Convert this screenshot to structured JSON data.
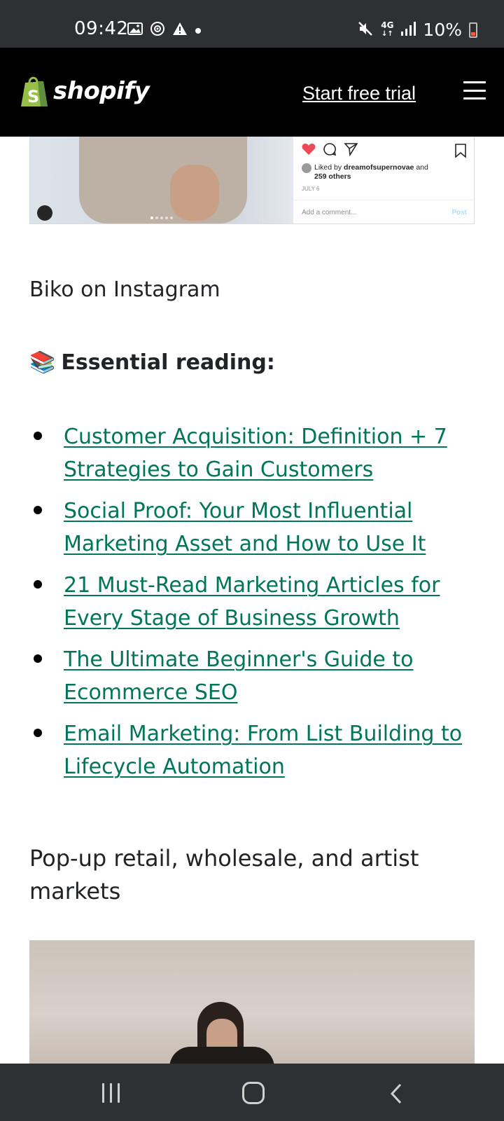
{
  "status_bar": {
    "time": "09:42",
    "battery_percent": "10%",
    "network": "4G",
    "icons_left": [
      "gallery-icon",
      "sync-icon",
      "alert-icon",
      "dot-icon"
    ],
    "icons_right": [
      "mute-icon",
      "4g-icon",
      "signal-icon",
      "battery-icon"
    ]
  },
  "header": {
    "logo_text": "shopify",
    "cta_label": "Start free trial",
    "menu_icon": "hamburger-menu-icon"
  },
  "instagram_embed": {
    "liked_by_prefix": "Liked by",
    "liked_by_user": "dreamofsupernovae",
    "liked_by_and": "and",
    "liked_by_others": "259 others",
    "date": "JULY 6",
    "comment_placeholder": "Add a comment...",
    "post_label": "Post",
    "colors": {
      "heart": "#ed4956",
      "post": "#b2dffc"
    }
  },
  "caption": "Biko on Instagram",
  "essential_reading": {
    "emoji": "📚",
    "title": "Essential reading:",
    "links": [
      {
        "label": "Customer Acquisition: Definition + 7 Strategies to Gain Customers"
      },
      {
        "label": "Social Proof: Your Most Influential Marketing Asset and How to Use It"
      },
      {
        "label": "21 Must-Read Marketing Articles for Every Stage of Business Growth"
      },
      {
        "label": "The Ultimate Beginner's Guide to Ecommerce SEO"
      },
      {
        "label": "Email Marketing: From List Building to Lifecycle Automation"
      }
    ],
    "link_color": "#007559"
  },
  "section_heading": "Pop-up retail, wholesale, and artist markets",
  "nav_bar": {
    "icons": [
      "recent-apps-icon",
      "home-icon",
      "back-icon"
    ]
  }
}
